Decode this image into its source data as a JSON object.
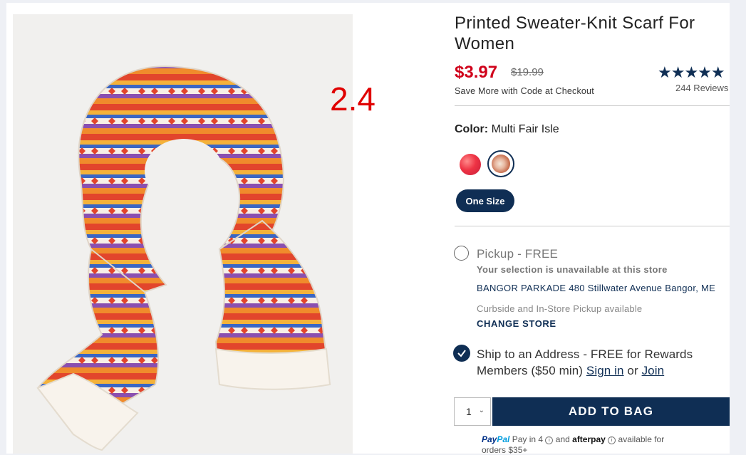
{
  "annotation": "2.4",
  "product": {
    "title": "Printed Sweater-Knit Scarf For Women",
    "price": "$3.97",
    "original_price": "$19.99",
    "promo": "Save More with Code at Checkout",
    "stars": "★★★★★",
    "review_count": "244 Reviews"
  },
  "color": {
    "label": "Color:",
    "value": "Multi Fair Isle",
    "swatches": [
      "red-swatch",
      "multi-fair-isle-swatch"
    ]
  },
  "size": {
    "label": "One Size"
  },
  "pickup": {
    "label": "Pickup - FREE",
    "unavailable": "Your selection is unavailable at this store",
    "store": "BANGOR PARKADE 480 Stillwater Avenue  Bangor, ME",
    "curbside": "Curbside and In-Store Pickup available",
    "change_store": "CHANGE STORE"
  },
  "ship": {
    "text": "Ship to an Address - FREE for Rewards Members ($50 min)",
    "sign_in": "Sign in",
    "or": "or",
    "join": "Join"
  },
  "cart": {
    "quantity": "1",
    "add_to_bag": "ADD TO BAG"
  },
  "payment": {
    "paypal_brand1": "Pay",
    "paypal_brand2": "Pal",
    "paypal_text": "Pay in 4",
    "and": "and",
    "afterpay": "afterpay",
    "available": "available for",
    "orders": "orders $35+"
  },
  "colors": {
    "navy": "#0f2e54",
    "sale_red": "#d0021b"
  }
}
